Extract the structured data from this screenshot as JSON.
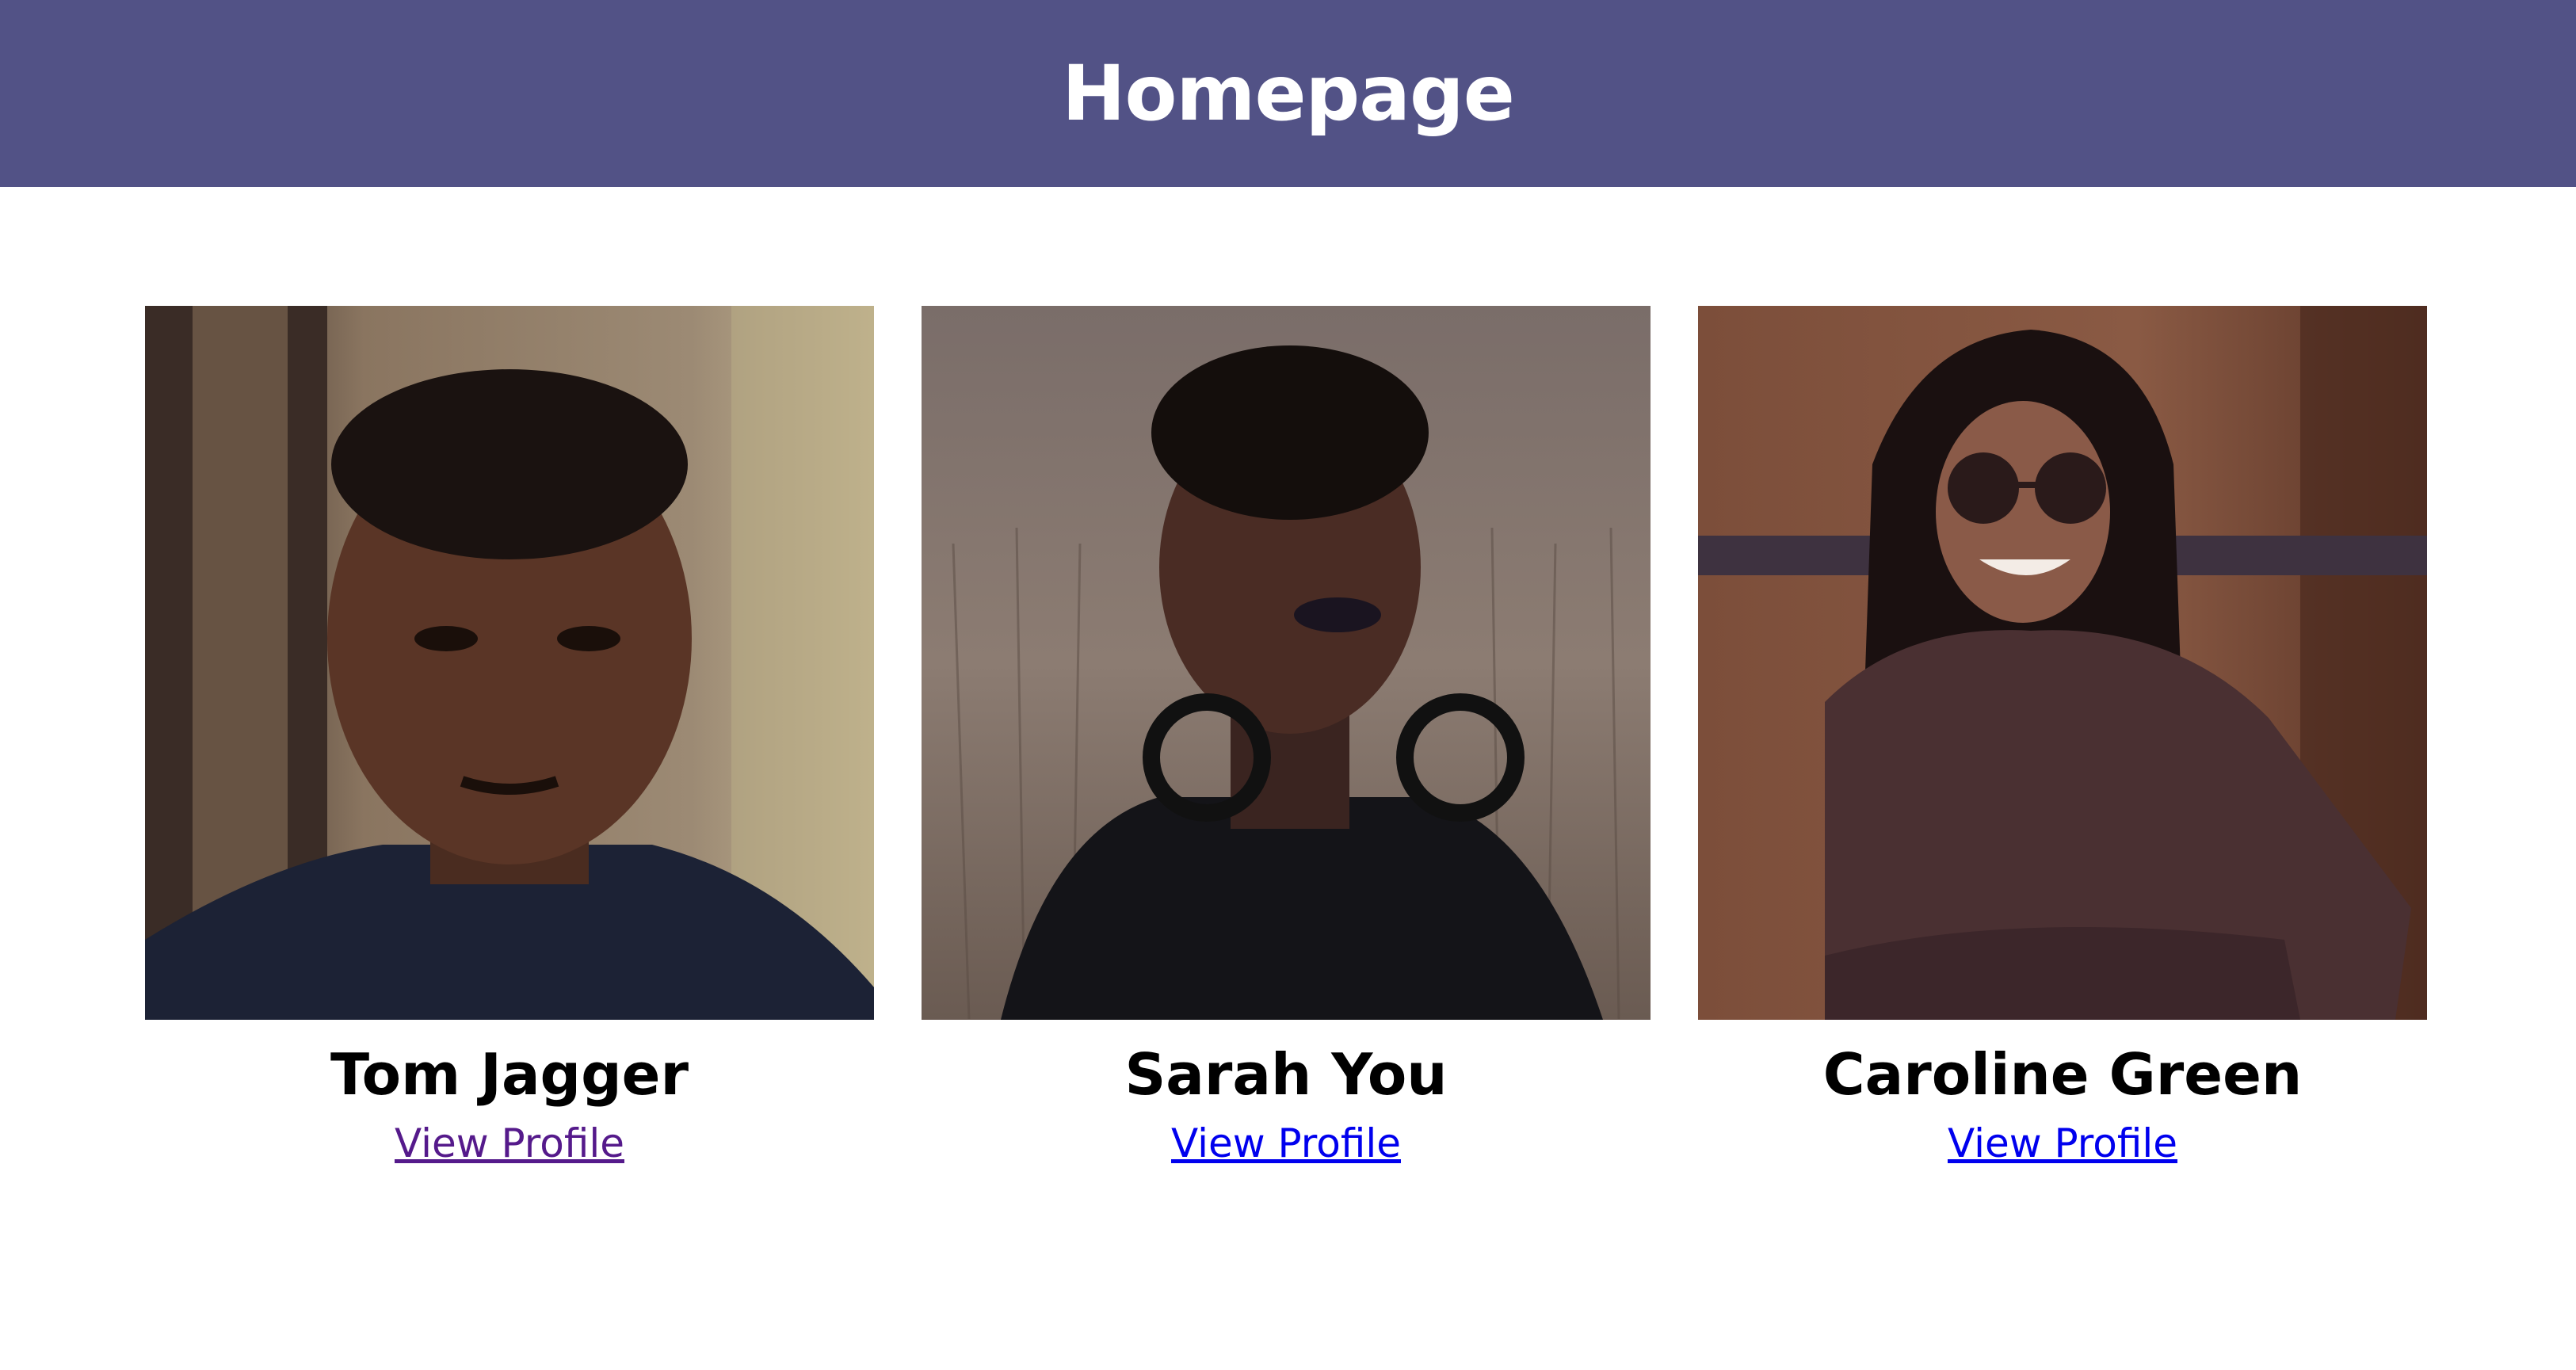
{
  "header": {
    "title": "Homepage",
    "background_color": "#525286"
  },
  "profiles": [
    {
      "name": "Tom Jagger",
      "link_label": "View Profile",
      "link_state": "visited",
      "photo": "portrait-man-avatar"
    },
    {
      "name": "Sarah You",
      "link_label": "View Profile",
      "link_state": "unvisited",
      "photo": "portrait-woman-avatar"
    },
    {
      "name": "Caroline Green",
      "link_label": "View Profile",
      "link_state": "unvisited",
      "photo": "portrait-woman-sunglasses-avatar"
    }
  ],
  "colors": {
    "link_visited": "#551a8b",
    "link_unvisited": "#0000ee"
  }
}
